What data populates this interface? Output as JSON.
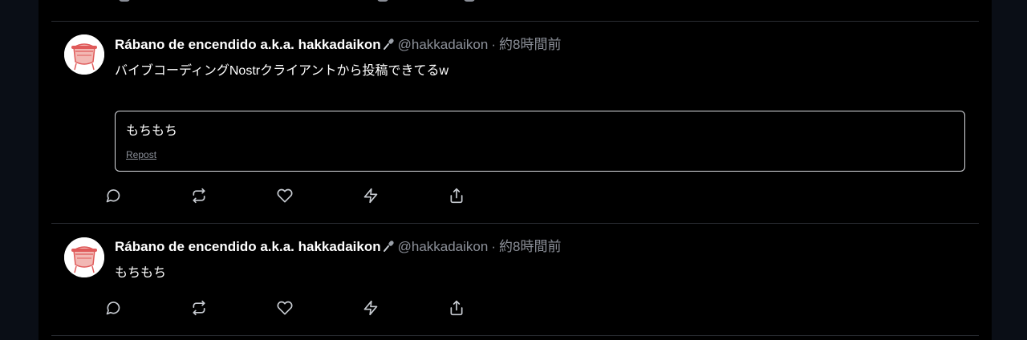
{
  "posts": [
    {
      "author": {
        "display_name": "Rábano de encendido a.k.a. hakkadaikon",
        "badge_icon": "microphone-icon",
        "handle": "@hakkadaikon",
        "separator": "·",
        "time": "約8時間前"
      },
      "content": "バイブコーディングNostrクライアントから投稿できてるw",
      "quote": {
        "text": "もちもち",
        "repost_label": "Repost"
      },
      "actions": [
        "reply-icon",
        "repost-icon",
        "like-icon",
        "zap-icon",
        "share-icon"
      ]
    },
    {
      "author": {
        "display_name": "Rábano de encendido a.k.a. hakkadaikon",
        "badge_icon": "microphone-icon",
        "handle": "@hakkadaikon",
        "separator": "·",
        "time": "約8時間前"
      },
      "content": "もちもち",
      "actions": [
        "reply-icon",
        "repost-icon",
        "like-icon",
        "zap-icon",
        "share-icon"
      ]
    }
  ],
  "colors": {
    "background": "#000000",
    "outer_background": "#0b0f17",
    "muted_text": "#8b8f98",
    "divider": "#2a2d33",
    "quote_border": "#d9dbe0",
    "avatar_accent": "#e05a5a"
  }
}
